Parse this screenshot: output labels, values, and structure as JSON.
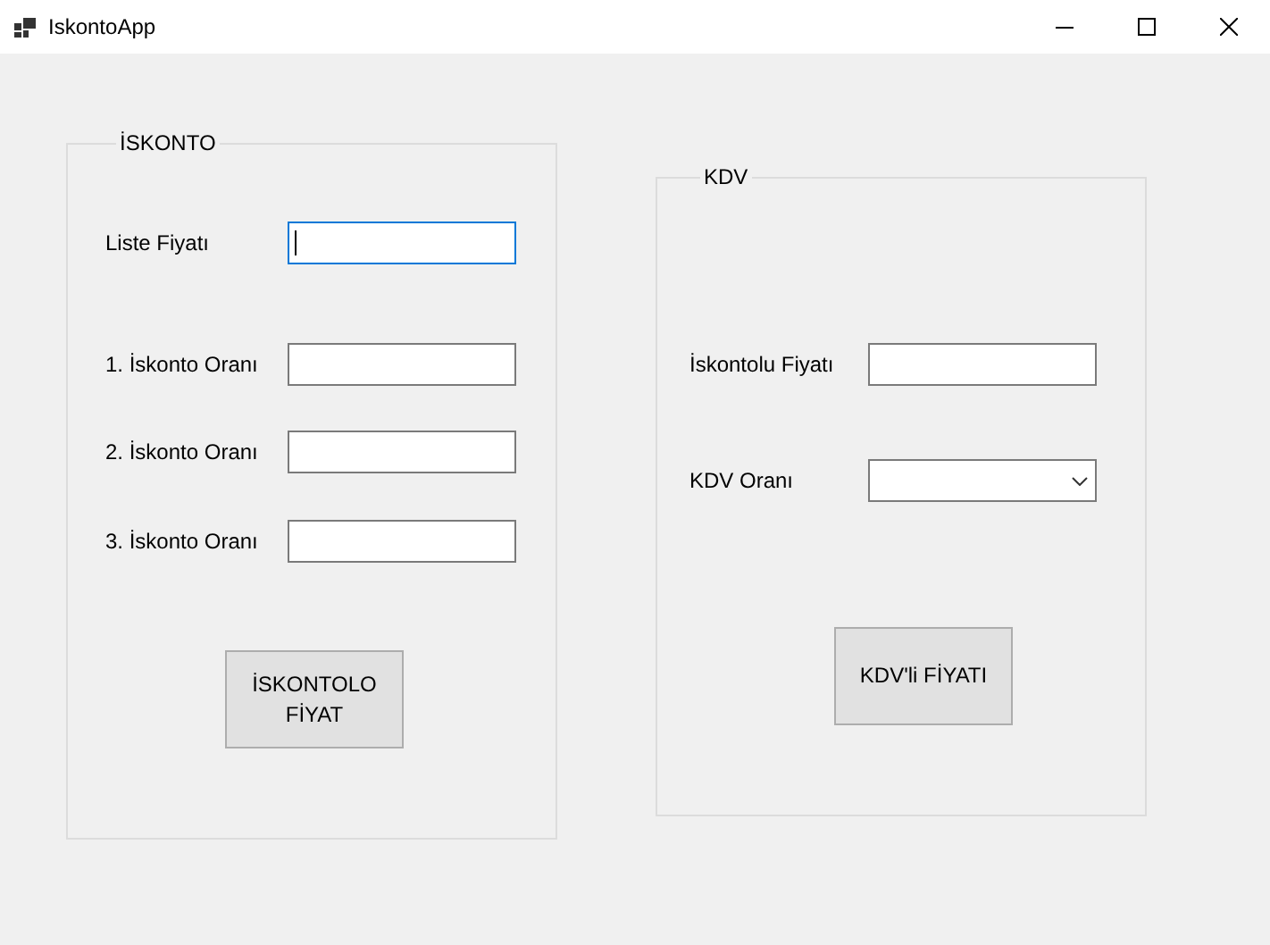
{
  "window": {
    "title": "IskontoApp"
  },
  "groups": [
    {
      "title": "İSKONTO",
      "fields": [
        {
          "label": "Liste Fiyatı",
          "kind": "text",
          "focused": true
        },
        {
          "label": "1. İskonto Oranı",
          "kind": "text",
          "focused": false
        },
        {
          "label": "2. İskonto Oranı",
          "kind": "text",
          "focused": false
        },
        {
          "label": "3. İskonto Oranı",
          "kind": "text",
          "focused": false
        }
      ],
      "button": "İSKONTOLO FİYAT"
    },
    {
      "title": "KDV",
      "fields": [
        {
          "label": "İskontolu Fiyatı",
          "kind": "text",
          "focused": false
        },
        {
          "label": "KDV Oranı",
          "kind": "select",
          "focused": false
        }
      ],
      "button": "KDV'li FİYATI"
    }
  ]
}
